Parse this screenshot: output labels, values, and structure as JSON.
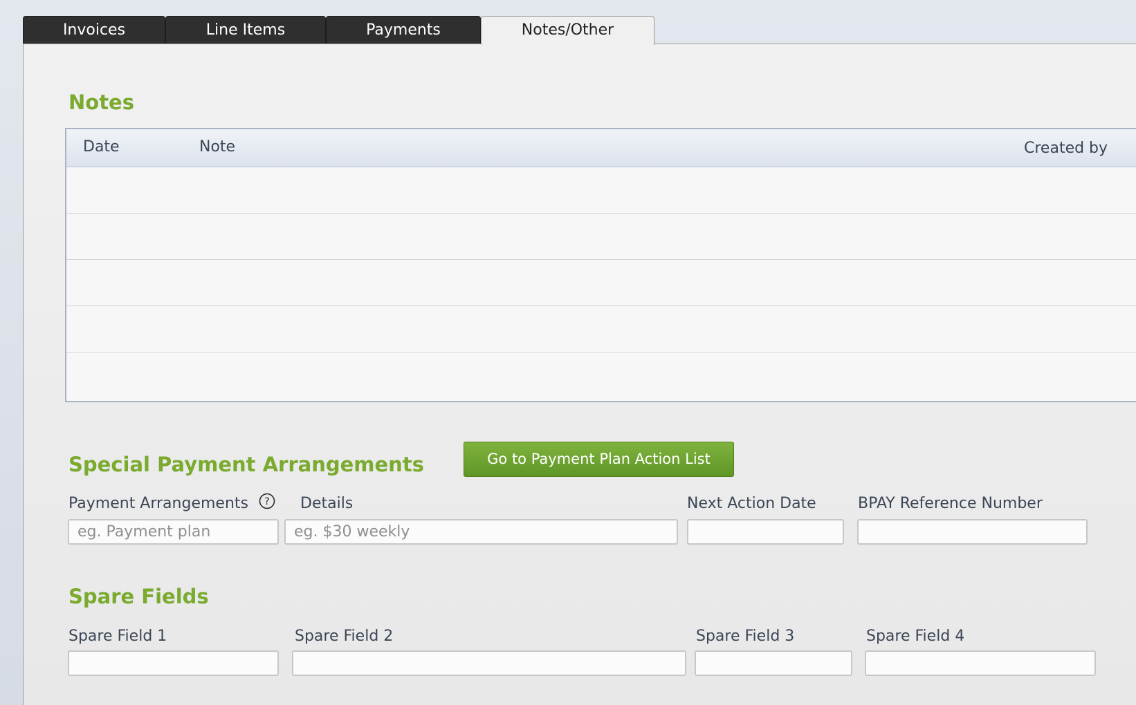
{
  "tabs": [
    {
      "label": "Invoices",
      "active": false
    },
    {
      "label": "Line Items",
      "active": false
    },
    {
      "label": "Payments",
      "active": false
    },
    {
      "label": "Notes/Other",
      "active": true
    }
  ],
  "notes": {
    "title": "Notes",
    "columns": {
      "date": "Date",
      "note": "Note",
      "created_by": "Created by"
    },
    "rows": []
  },
  "special_payment": {
    "title": "Special Payment Arrangements",
    "action_button_label": "Go to Payment Plan Action List",
    "payment_arrangements": {
      "label": "Payment Arrangements",
      "placeholder": "eg. Payment plan",
      "value": ""
    },
    "details": {
      "label": "Details",
      "placeholder": "eg. $30 weekly",
      "value": ""
    },
    "next_action_date": {
      "label": "Next Action Date",
      "value": ""
    },
    "bpay_reference": {
      "label": "BPAY Reference Number",
      "value": ""
    },
    "help_icon": "question-circle-icon"
  },
  "spare_fields": {
    "title": "Spare Fields",
    "fields": [
      {
        "label": "Spare Field 1",
        "value": ""
      },
      {
        "label": "Spare Field 2",
        "value": ""
      },
      {
        "label": "Spare Field 3",
        "value": ""
      },
      {
        "label": "Spare Field 4",
        "value": ""
      }
    ]
  },
  "colors": {
    "accent_green": "#7aaa2e",
    "button_green": "#6a9f2d",
    "tab_dark": "#2f2f2f"
  }
}
